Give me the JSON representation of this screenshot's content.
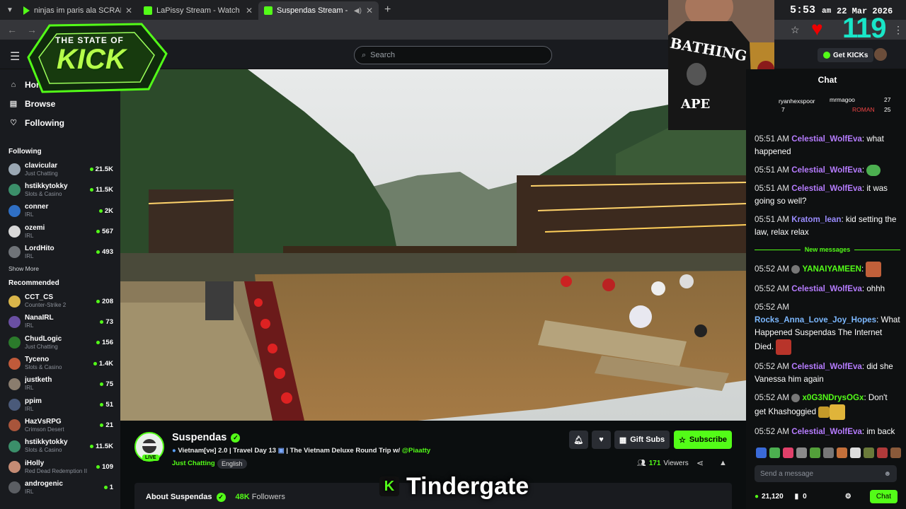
{
  "browser": {
    "tabs": [
      {
        "title": "ninjas im paris ala SCRABSNYC"
      },
      {
        "title": "LaPissy Stream - Watch Live on"
      },
      {
        "title": "Suspendas Stream - Watch"
      }
    ]
  },
  "overlay": {
    "clock": "5:53",
    "ampm": "am",
    "date": "22 Mar 2026",
    "viewer_counter": "119",
    "logo_line1": "THE STATE OF",
    "logo_line2": "KICK",
    "banner": "Tindergate",
    "webcam_shirt_top": "BATHING",
    "webcam_shirt_bottom": "APE"
  },
  "header": {
    "search_placeholder": "Search",
    "get_kicks": "Get KICKs"
  },
  "sidebar": {
    "nav": [
      {
        "label": "Home",
        "icon": "home-icon"
      },
      {
        "label": "Browse",
        "icon": "browse-icon"
      },
      {
        "label": "Following",
        "icon": "heart-icon"
      }
    ],
    "following_title": "Following",
    "following": [
      {
        "name": "clavicular",
        "category": "Just Chatting",
        "viewers": "21.5K",
        "color": "#9aa7b3"
      },
      {
        "name": "hstikkytokky",
        "category": "Slots & Casino",
        "viewers": "11.5K",
        "color": "#3b8f6a"
      },
      {
        "name": "conner",
        "category": "IRL",
        "viewers": "2K",
        "color": "#2f6fc4"
      },
      {
        "name": "ozemi",
        "category": "IRL",
        "viewers": "567",
        "color": "#d8d8d8"
      },
      {
        "name": "LordHito",
        "category": "IRL",
        "viewers": "493",
        "color": "#6f7378"
      }
    ],
    "show_more": "Show More",
    "recommended_title": "Recommended",
    "recommended": [
      {
        "name": "CCT_CS",
        "category": "Counter-Strike 2",
        "viewers": "208",
        "color": "#d9b54a"
      },
      {
        "name": "NanaIRL",
        "category": "IRL",
        "viewers": "73",
        "color": "#6a4fa3"
      },
      {
        "name": "ChudLogic",
        "category": "Just Chatting",
        "viewers": "156",
        "color": "#2b7a2b"
      },
      {
        "name": "Tyceno",
        "category": "Slots & Casino",
        "viewers": "1.4K",
        "color": "#c05a3a"
      },
      {
        "name": "justketh",
        "category": "IRL",
        "viewers": "75",
        "color": "#8a7d6e"
      },
      {
        "name": "ppim",
        "category": "IRL",
        "viewers": "51",
        "color": "#4a5a7a"
      },
      {
        "name": "HazVsRPG",
        "category": "Crimson Desert",
        "viewers": "21",
        "color": "#a8553b"
      },
      {
        "name": "hstikkytokky",
        "category": "Slots & Casino",
        "viewers": "11.5K",
        "color": "#3b8f6a"
      },
      {
        "name": "iHolly",
        "category": "Red Dead Redemption II",
        "viewers": "109",
        "color": "#c48b74"
      },
      {
        "name": "androgenic",
        "category": "IRL",
        "viewers": "1",
        "color": "#5b5e63"
      }
    ]
  },
  "channel": {
    "name": "Suspendas",
    "live": "LIVE",
    "title_prefix": "Vietnam[vн] 2.0 | Travel Day 13 ",
    "title_suffix": " | The Vietnam Deluxe Round Trip w/ ",
    "mention": "@Piaatty",
    "category": "Just Chatting",
    "tag": "English",
    "viewers": "171",
    "viewers_label": "Viewers",
    "gift_subs": "Gift Subs",
    "subscribe": "Subscribe",
    "about": "About Suspendas",
    "followers": "48K",
    "followers_label": "Followers"
  },
  "chat": {
    "title": "Chat",
    "gifters": [
      {
        "name": "ryanhexspoor"
      },
      {
        "name": "mrmagoo",
        "count": "27"
      },
      {
        "name": "ROMAN",
        "count": "25"
      },
      {
        "count": "7"
      }
    ],
    "messages": [
      {
        "time": "05:51 AM",
        "user": "Celestial_WolfEva",
        "color": "#b67cff",
        "text": "what happened"
      },
      {
        "time": "05:51 AM",
        "user": "Celestial_WolfEva",
        "color": "#b67cff",
        "text": ""
      },
      {
        "time": "05:51 AM",
        "user": "Celestial_WolfEva",
        "color": "#b67cff",
        "text": "it was going so well?"
      },
      {
        "time": "05:51 AM",
        "user": "Kratom_lean",
        "color": "#9a8cff",
        "text": "kid setting the law, relax relax"
      }
    ],
    "new_messages": "New messages",
    "messages2": [
      {
        "time": "05:52 AM",
        "user": "YANAIYAMEEN",
        "color": "#53fc18",
        "text": ""
      },
      {
        "time": "05:52 AM",
        "user": "Celestial_WolfEva",
        "color": "#b67cff",
        "text": "ohhh"
      },
      {
        "time": "05:52 AM",
        "user": "Rocks_Anna_Love_Joy_Hopes",
        "color": "#7cb8ff",
        "text": "What Happened Suspendas The Internet Died."
      },
      {
        "time": "05:52 AM",
        "user": "Celestial_WolfEva",
        "color": "#b67cff",
        "text": "did she Vanessa him again"
      },
      {
        "time": "05:52 AM",
        "user": "x0G3NDrysOGx",
        "color": "#53fc18",
        "text": "Don't get Khashoggied"
      },
      {
        "time": "05:52 AM",
        "user": "Celestial_WolfEva",
        "color": "#b67cff",
        "text": "im back"
      }
    ],
    "send_placeholder": "Send a message",
    "kicks_balance": "21,120",
    "second_balance": "0",
    "chat_button": "Chat"
  }
}
